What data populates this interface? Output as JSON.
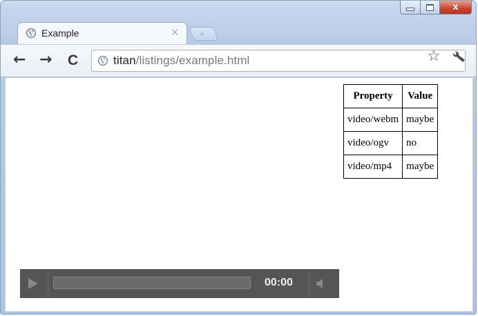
{
  "browser": {
    "tab": {
      "title": "Example",
      "close_glyph": "×",
      "favicon": "globe-icon"
    },
    "new_tab_glyph": "+",
    "window_controls": {
      "minimize": "minimize-icon",
      "maximize": "maximize-icon",
      "close": "x"
    },
    "nav": {
      "back": "←",
      "forward": "→",
      "reload": "C"
    },
    "address": {
      "host": "titan",
      "path": "/listings/example.html"
    },
    "star_glyph": "☆"
  },
  "page": {
    "table": {
      "headers": [
        "Property",
        "Value"
      ],
      "rows": [
        [
          "video/webm",
          "maybe"
        ],
        [
          "video/ogv",
          "no"
        ],
        [
          "video/mp4",
          "maybe"
        ]
      ]
    },
    "video": {
      "time": "00:00",
      "progress": 0
    }
  },
  "colors": {
    "frame": "#b8cbe6",
    "close": "#c8442c",
    "video_bar": "#555555"
  }
}
